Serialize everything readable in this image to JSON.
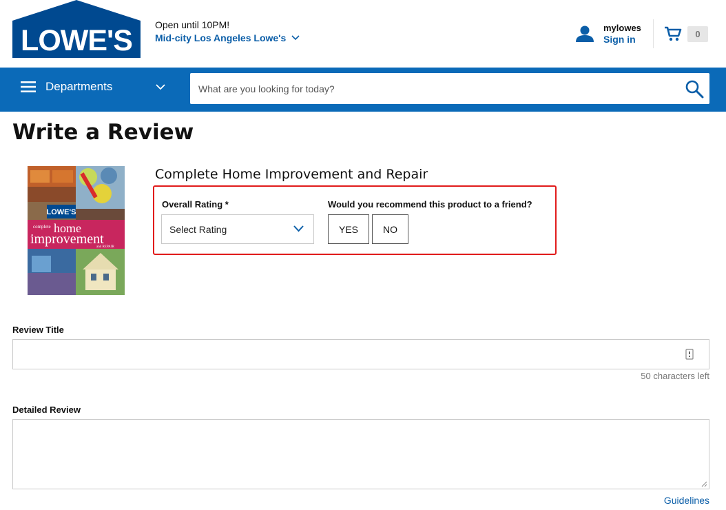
{
  "header": {
    "logo_text": "LOWE'S",
    "store_hours": "Open until 10PM!",
    "store_name": "Mid-city Los Angeles Lowe's",
    "account_label": "mylowes",
    "sign_in": "Sign in",
    "cart_count": "0"
  },
  "nav": {
    "departments": "Departments",
    "search_placeholder": "What are you looking for today?"
  },
  "page": {
    "title": "Write a Review",
    "product_name": "Complete Home Improvement and Repair",
    "product_cover": {
      "brand": "LOWE'S",
      "line1": "complete",
      "line2": "home",
      "line3": "improvement",
      "line4": "and REPAIR"
    }
  },
  "rating": {
    "label": "Overall Rating *",
    "select_value": "Select Rating"
  },
  "recommend": {
    "label": "Would you recommend this product to a friend?",
    "yes": "YES",
    "no": "NO"
  },
  "review_title": {
    "label": "Review Title",
    "value": "",
    "chars_left": "50 characters left"
  },
  "detailed_review": {
    "label": "Detailed Review",
    "value": ""
  },
  "guidelines": "Guidelines",
  "colors": {
    "brand_blue": "#0b6ab8",
    "link_blue": "#0b5ea8",
    "highlight_red": "#e11b1b",
    "logo_blue": "#004990"
  }
}
